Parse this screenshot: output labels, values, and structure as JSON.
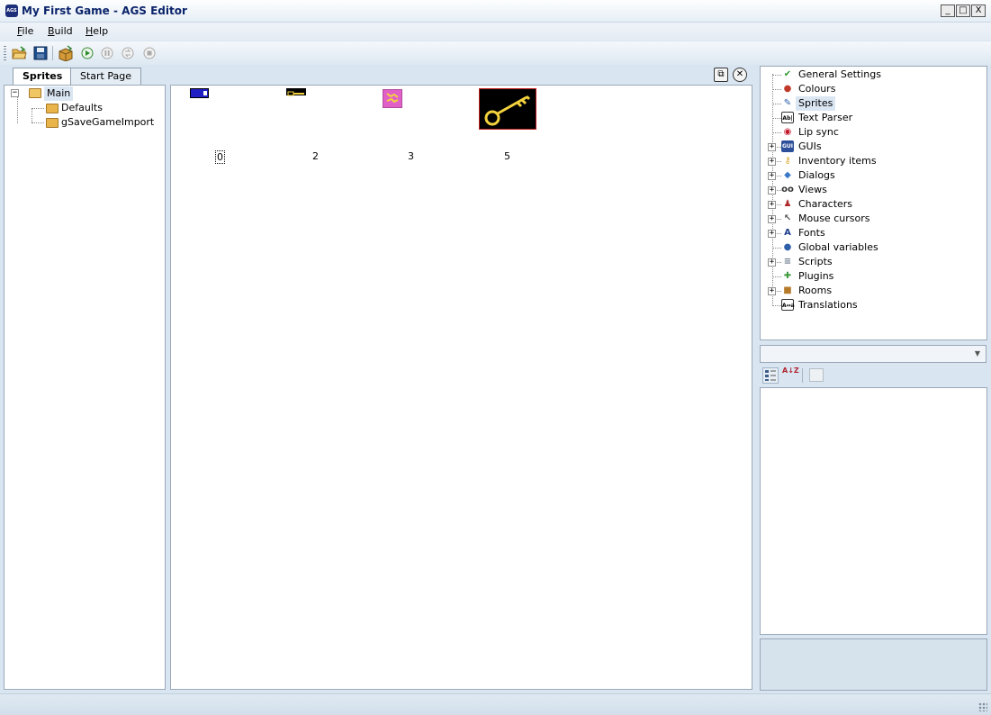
{
  "window": {
    "title": "My First Game - AGS Editor",
    "icon_text": "AGS",
    "minimize": "_",
    "maximize": "□",
    "close": "X"
  },
  "menu": [
    {
      "label": "File",
      "underline": "F",
      "rest": "ile"
    },
    {
      "label": "Build",
      "underline": "B",
      "rest": "uild"
    },
    {
      "label": "Help",
      "underline": "H",
      "rest": "elp"
    }
  ],
  "toolbar": {
    "icons": [
      "open-icon",
      "save-icon",
      "build-icon",
      "run-icon",
      "pause-icon",
      "step-icon",
      "stop-icon"
    ]
  },
  "tabs": [
    {
      "label": "Sprites",
      "active": true
    },
    {
      "label": "Start Page",
      "active": false
    }
  ],
  "doc_controls": {
    "restore": "⧉",
    "close": "✕"
  },
  "sprite_tree": {
    "root": {
      "label": "Main",
      "expander": "−"
    },
    "children": [
      "Defaults",
      "gSaveGameImport"
    ]
  },
  "sprites": [
    {
      "number": "0",
      "icon": "blue-panel-sprite"
    },
    {
      "number": "2",
      "icon": "small-key-sprite"
    },
    {
      "number": "3",
      "icon": "pink-item-sprite"
    },
    {
      "number": "5",
      "icon": "large-key-sprite"
    }
  ],
  "project_tree": [
    {
      "label": "General Settings",
      "icon": "checkmark-icon",
      "expandable": false
    },
    {
      "label": "Colours",
      "icon": "palette-icon",
      "expandable": false
    },
    {
      "label": "Sprites",
      "icon": "sprite-brush-icon",
      "expandable": false,
      "selected": true
    },
    {
      "label": "Text Parser",
      "icon": "text-parser-icon",
      "icon_text": "Ab|",
      "expandable": false
    },
    {
      "label": "Lip sync",
      "icon": "lips-icon",
      "expandable": false
    },
    {
      "label": "GUIs",
      "icon": "gui-icon",
      "icon_text": "GUI",
      "expandable": true
    },
    {
      "label": "Inventory items",
      "icon": "key-icon",
      "expandable": true
    },
    {
      "label": "Dialogs",
      "icon": "speech-bubble-icon",
      "expandable": true
    },
    {
      "label": "Views",
      "icon": "glasses-icon",
      "expandable": true
    },
    {
      "label": "Characters",
      "icon": "people-icon",
      "expandable": true
    },
    {
      "label": "Mouse cursors",
      "icon": "cursor-icon",
      "expandable": true
    },
    {
      "label": "Fonts",
      "icon": "font-icon",
      "icon_text": "A",
      "expandable": true
    },
    {
      "label": "Global variables",
      "icon": "globe-icon",
      "expandable": false
    },
    {
      "label": "Scripts",
      "icon": "script-icon",
      "expandable": true
    },
    {
      "label": "Plugins",
      "icon": "puzzle-icon",
      "expandable": false
    },
    {
      "label": "Rooms",
      "icon": "box-icon",
      "expandable": true
    },
    {
      "label": "Translations",
      "icon": "translation-icon",
      "icon_text": "A↔a",
      "expandable": false
    }
  ],
  "properties": {
    "combo_value": "",
    "toolbar_icons": [
      "categorized-icon",
      "alphabetical-icon",
      "property-pages-icon"
    ],
    "sort_glyph": "A↓Z"
  },
  "colors": {
    "title_text": "#0a246a",
    "selection": "#dbe6f3",
    "frame_bg": "#d9e6f1"
  }
}
